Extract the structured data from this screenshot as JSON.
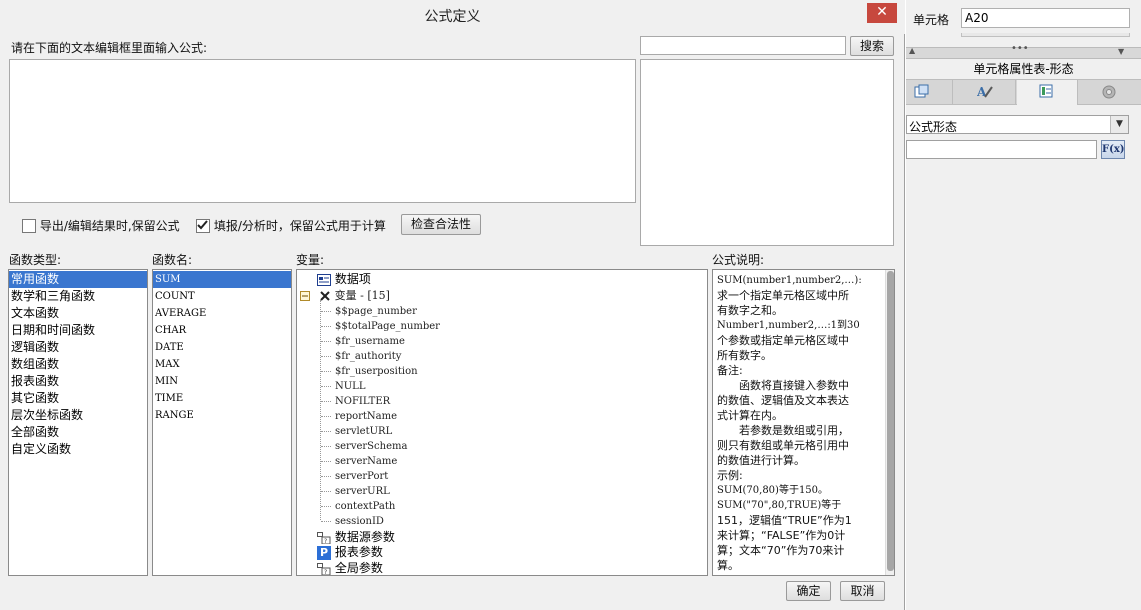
{
  "dialog": {
    "title": "公式定义",
    "close": "✕",
    "editor_prompt": "请在下面的文本编辑框里面输入公式:",
    "search_placeholder": "",
    "search_button": "搜索",
    "export_checkbox": {
      "label": "导出/编辑结果时,保留公式",
      "checked": false
    },
    "fill_checkbox": {
      "label": "填报/分析时，保留公式用于计算",
      "checked": true
    },
    "check_button": "检查合法性",
    "category_header": "函数类型:",
    "funcname_header": "函数名:",
    "variable_header": "变量:",
    "explain_header": "公式说明:",
    "categories": [
      "常用函数",
      "数学和三角函数",
      "文本函数",
      "日期和时间函数",
      "逻辑函数",
      "数组函数",
      "报表函数",
      "其它函数",
      "层次坐标函数",
      "全部函数",
      "自定义函数"
    ],
    "functions": [
      "SUM",
      "COUNT",
      "AVERAGE",
      "CHAR",
      "DATE",
      "MAX",
      "MIN",
      "TIME",
      "RANGE"
    ],
    "tree": {
      "data_item": "数据项",
      "variables_node": "变量 - [15]",
      "variables": [
        "$$page_number",
        "$$totalPage_number",
        "$fr_username",
        "$fr_authority",
        "$fr_userposition",
        "NULL",
        "NOFILTER",
        "reportName",
        "servletURL",
        "serverSchema",
        "serverName",
        "serverPort",
        "serverURL",
        "contextPath",
        "sessionID"
      ],
      "datasource_params": "数据源参数",
      "report_params": "报表参数",
      "global_params": "全局参数"
    },
    "explanation": [
      "SUM(number1,number2,…):",
      "求一个指定单元格区域中所",
      "有数字之和。",
      "Number1,number2,…:1到30",
      "个参数或指定单元格区域中",
      "所有数字。",
      "备注:",
      "　　函数将直接键入参数中",
      "的数值、逻辑值及文本表达",
      "式计算在内。",
      "　　若参数是数组或引用，",
      "则只有数组或单元格引用中",
      "的数值进行计算。",
      "示例:",
      "SUM(70,80)等于150。",
      "SUM(\"70\",80,TRUE)等于",
      "151，逻辑值“TRUE”作为1",
      "来计算；“FALSE”作为0计",
      "算；文本“70”作为70来计",
      "算。"
    ],
    "ok_button": "确定",
    "cancel_button": "取消"
  },
  "side_panel": {
    "cell_label": "单元格",
    "cell_value": "A20",
    "panel_title": "单元格属性表-形态",
    "form_select": "公式形态",
    "fx_button": "F(x)",
    "tabs": [
      "style-tab-icon",
      "format-tab-icon",
      "form-tab-icon",
      "settings-tab-icon"
    ]
  }
}
